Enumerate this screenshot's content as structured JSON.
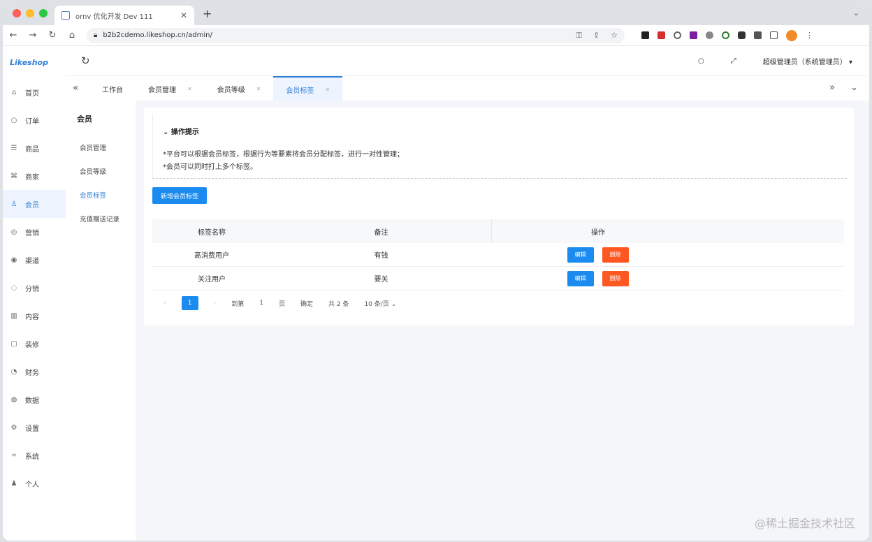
{
  "browser": {
    "tab_title": "ornv 优化开发 Dev 111",
    "url": "b2b2cdemo.likeshop.cn/admin/"
  },
  "app": {
    "logo": "Likeshop",
    "user": "超级管理员（系统管理员）"
  },
  "sidebar": {
    "items": [
      {
        "label": "首页",
        "icon": "home-icon"
      },
      {
        "label": "订单",
        "icon": "order-icon"
      },
      {
        "label": "商品",
        "icon": "goods-icon"
      },
      {
        "label": "商家",
        "icon": "shop-icon"
      },
      {
        "label": "会员",
        "icon": "user-icon",
        "active": true
      },
      {
        "label": "营销",
        "icon": "marketing-icon"
      },
      {
        "label": "渠道",
        "icon": "channel-icon"
      },
      {
        "label": "分销",
        "icon": "distribution-icon"
      },
      {
        "label": "内容",
        "icon": "content-icon"
      },
      {
        "label": "装修",
        "icon": "decoration-icon"
      },
      {
        "label": "财务",
        "icon": "finance-icon"
      },
      {
        "label": "数据",
        "icon": "data-icon"
      },
      {
        "label": "设置",
        "icon": "settings-icon"
      },
      {
        "label": "系统",
        "icon": "system-icon"
      },
      {
        "label": "个人",
        "icon": "person-icon"
      }
    ]
  },
  "submenu": {
    "title": "会员",
    "items": [
      {
        "label": "会员管理"
      },
      {
        "label": "会员等级"
      },
      {
        "label": "会员标签",
        "active": true
      },
      {
        "label": "充值赠送记录"
      }
    ]
  },
  "page_tabs": [
    {
      "label": "工作台"
    },
    {
      "label": "会员管理"
    },
    {
      "label": "会员等级"
    },
    {
      "label": "会员标签",
      "active": true
    }
  ],
  "tips": {
    "title": "操作提示",
    "lines": [
      "*平台可以根据会员标签，根据行为等要素将会员分配标签，进行一对性管理；",
      "*会员可以同时打上多个标签。"
    ]
  },
  "add_button": "新增会员标签",
  "table": {
    "headers": [
      "标签名称",
      "备注",
      "操作"
    ],
    "rows": [
      {
        "name": "高消费用户",
        "remark": "有钱",
        "edit": "编辑",
        "delete": "删除"
      },
      {
        "name": "关注用户",
        "remark": "要关",
        "edit": "编辑",
        "delete": "删除"
      }
    ]
  },
  "pagination": {
    "current": "1",
    "goto_label": "到第",
    "page_input": "1",
    "page_unit": "页",
    "confirm": "确定",
    "total": "共 2 条",
    "page_size": "10 条/页"
  },
  "watermark": "@稀土掘金技术社区"
}
